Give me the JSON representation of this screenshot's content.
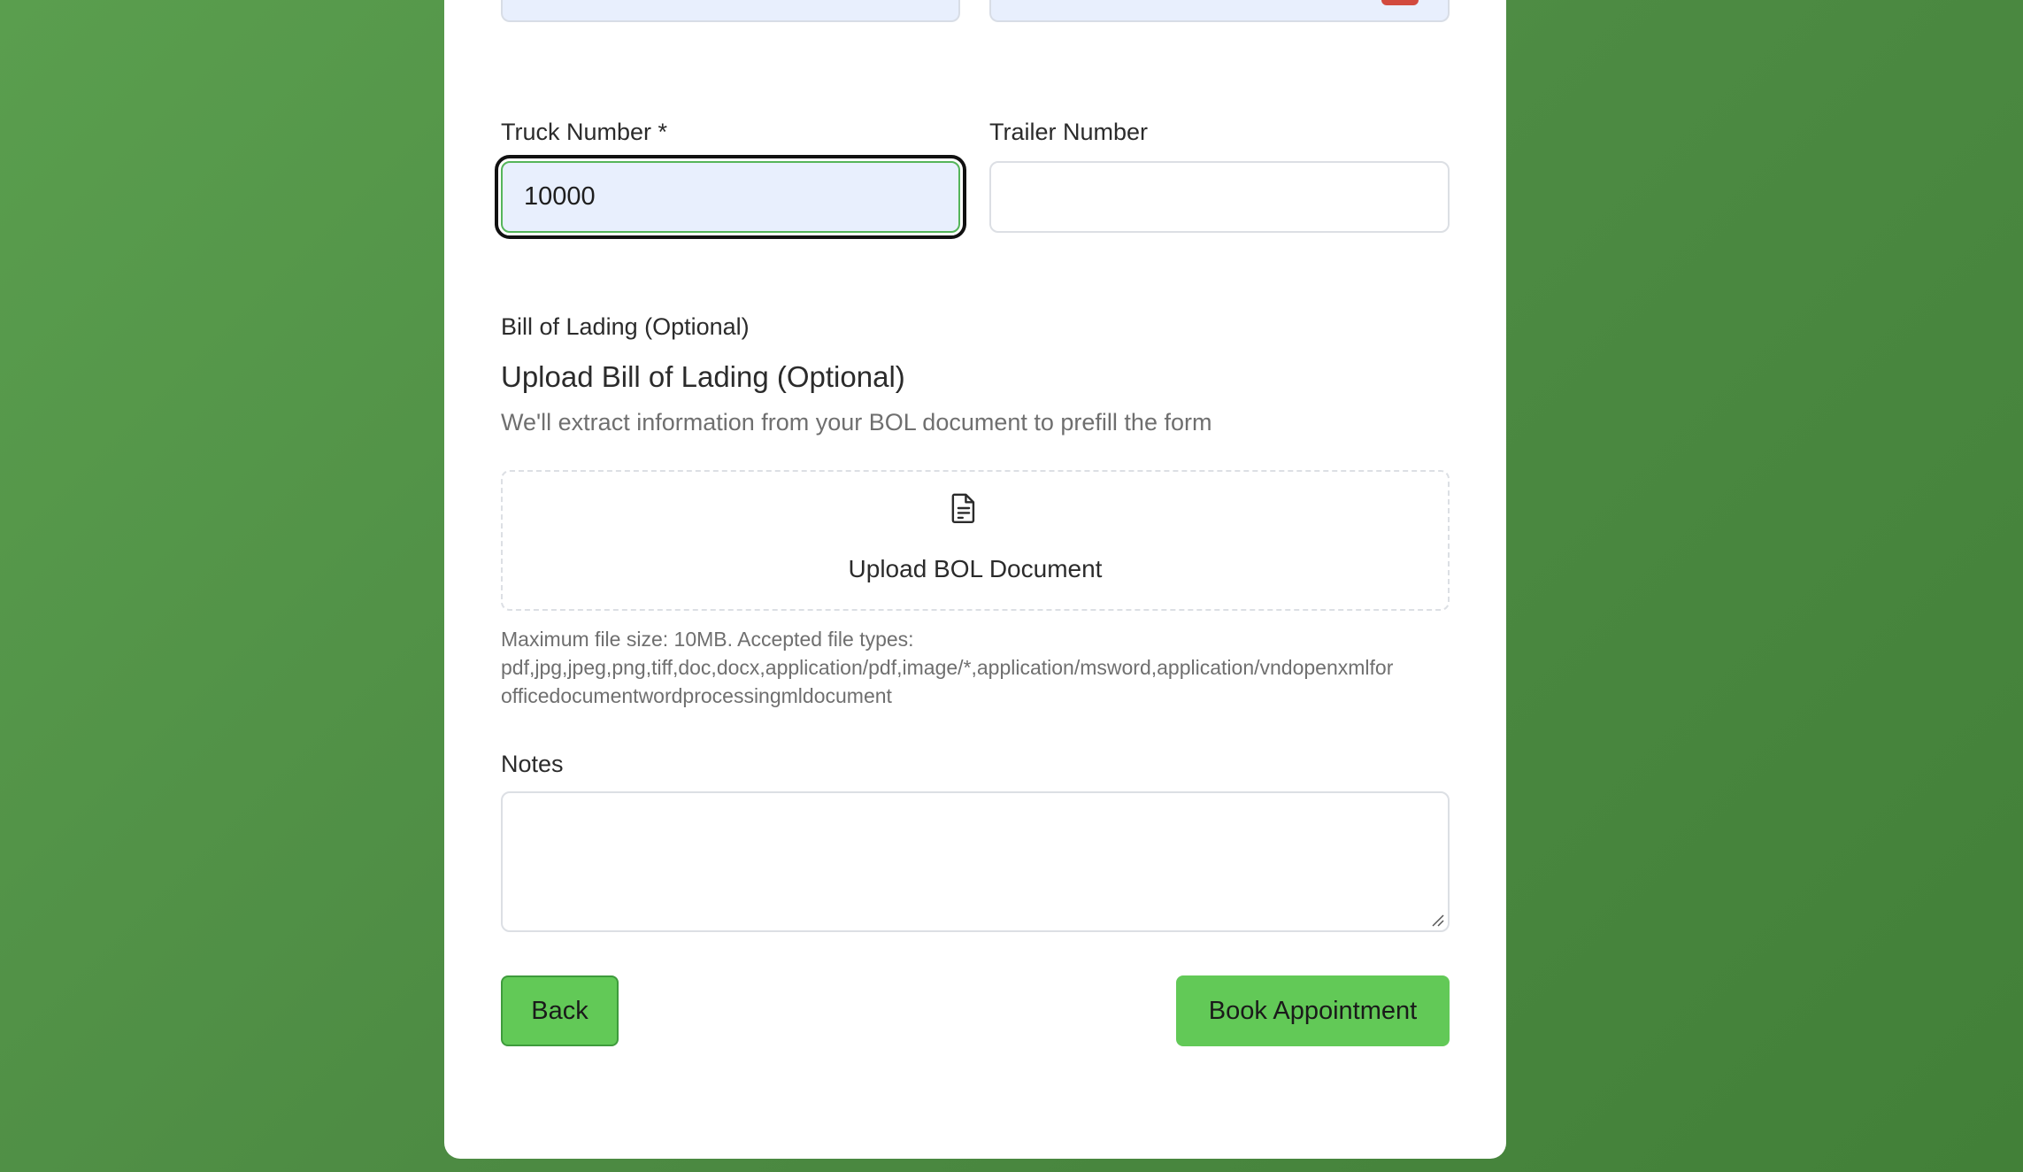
{
  "form": {
    "truck_number": {
      "label": "Truck Number *",
      "value": "10000"
    },
    "trailer_number": {
      "label": "Trailer Number",
      "value": ""
    },
    "bol": {
      "section_label": "Bill of Lading (Optional)",
      "upload_title": "Upload Bill of Lading (Optional)",
      "description": "We'll extract information from your BOL document to prefill the form",
      "dropzone_label": "Upload BOL Document",
      "dropzone_icon": "document-icon",
      "hint_line1": "Maximum file size: 10MB. Accepted file types:",
      "hint_line2": "pdf,jpg,jpeg,png,tiff,doc,docx,application/pdf,image/*,application/msword,application/vndopenxmlfor",
      "hint_line3": "officedocumentwordprocessingmldocument"
    },
    "notes": {
      "label": "Notes",
      "value": ""
    }
  },
  "actions": {
    "back_label": "Back",
    "book_label": "Book Appointment"
  },
  "colors": {
    "background": "#4d8b43",
    "button": "#62c957",
    "focus_border": "#55b55a",
    "field_fill": "#e8effd"
  }
}
